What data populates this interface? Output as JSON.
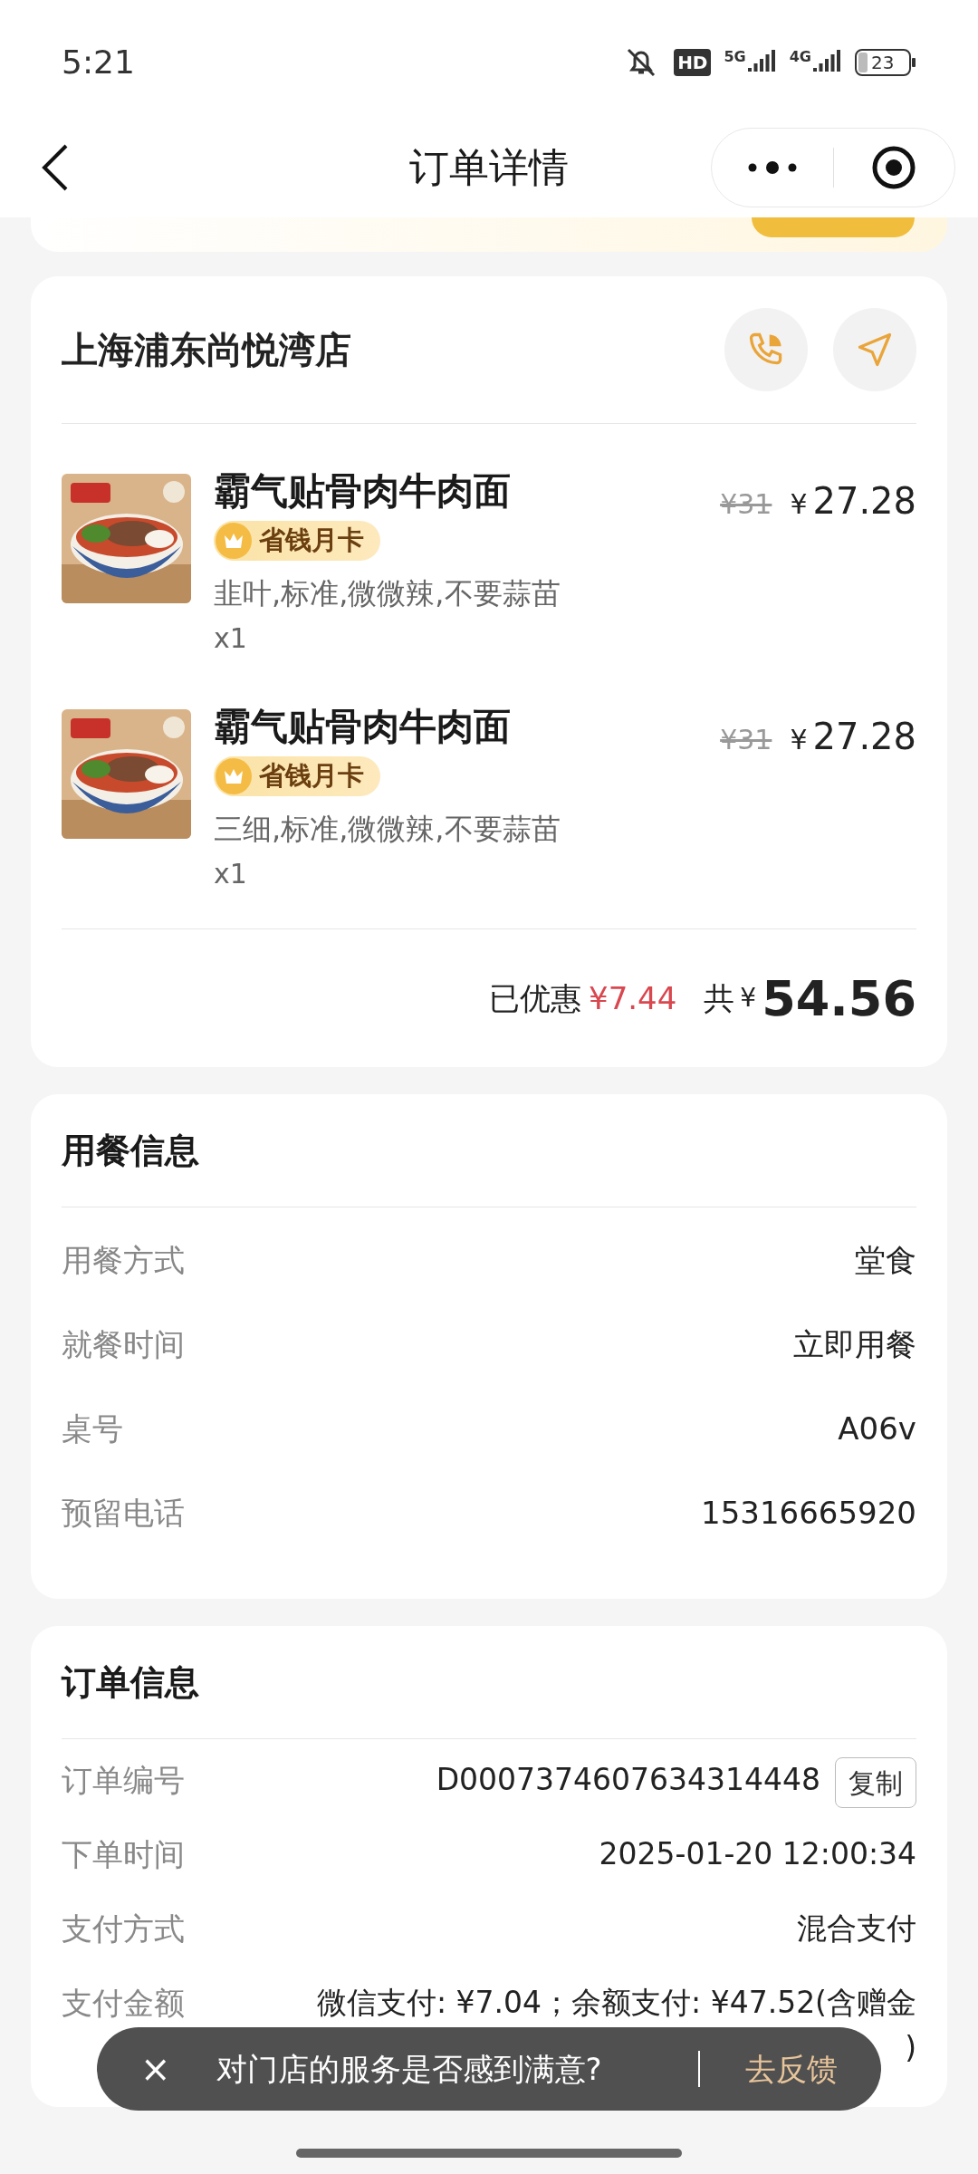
{
  "status_bar": {
    "time": "5:21",
    "hd": "HD",
    "networks": [
      "5G",
      "4G"
    ],
    "battery": "23"
  },
  "header": {
    "title": "订单详情"
  },
  "store": {
    "name": "上海浦东尚悦湾店",
    "items": [
      {
        "kind": "picture",
        "name": "霸气贴骨肉牛肉面",
        "badge": "省钱月卡",
        "specs": "韭叶,标准,微微辣,不要蒜苗",
        "qty": "x1",
        "original_price": "¥31",
        "currency": "¥",
        "price": "27.28"
      },
      {
        "kind": "picture",
        "name": "霸气贴骨肉牛肉面",
        "badge": "省钱月卡",
        "specs": "三细,标准,微微辣,不要蒜苗",
        "qty": "x1",
        "original_price": "¥31",
        "currency": "¥",
        "price": "27.28"
      }
    ],
    "discount_label": "已优惠",
    "discount": "¥7.44",
    "total_label": "共",
    "total_currency": "¥",
    "total": "54.56"
  },
  "dining_info": {
    "title": "用餐信息",
    "rows": [
      {
        "label": "用餐方式",
        "value": "堂食"
      },
      {
        "label": "就餐时间",
        "value": "立即用餐"
      },
      {
        "label": "桌号",
        "value": "A06v"
      },
      {
        "label": "预留电话",
        "value": "15316665920"
      }
    ]
  },
  "order_info": {
    "title": "订单信息",
    "rows": [
      {
        "label": "订单编号",
        "value": "D0007374607634314448",
        "action": "复制"
      },
      {
        "label": "下单时间",
        "value": "2025-01-20 12:00:34"
      },
      {
        "label": "支付方式",
        "value": "混合支付"
      },
      {
        "label": "支付金额",
        "value_lines": [
          "微信支付: ¥7.04；余额支付: ¥47.52(含赠金",
          ")"
        ]
      }
    ]
  },
  "toast": {
    "close": "×",
    "message": "对门店的服务是否感到满意?",
    "action": "去反馈"
  }
}
